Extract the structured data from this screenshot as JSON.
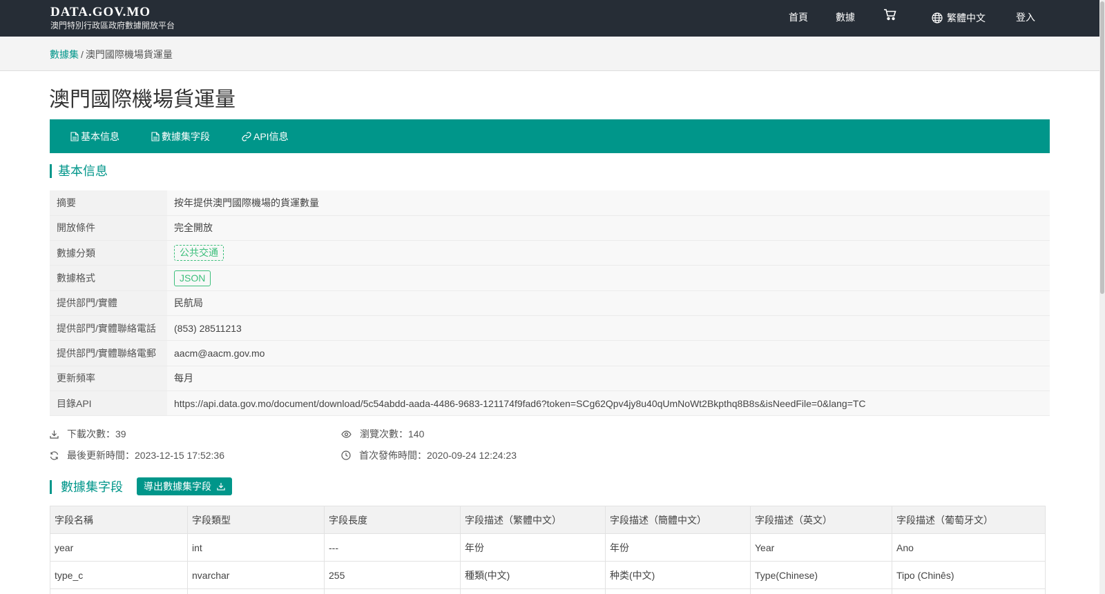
{
  "header": {
    "brand_title": "DATA.GOV.MO",
    "brand_subtitle": "澳門特別行政區政府數據開放平台",
    "nav": {
      "home": "首頁",
      "data": "數據",
      "language": "繁體中文",
      "login": "登入"
    }
  },
  "breadcrumb": {
    "root": "數據集",
    "separator": "/",
    "current": "澳門國際機場貨運量"
  },
  "page": {
    "title": "澳門國際機場貨運量"
  },
  "tabs": [
    {
      "label": "基本信息",
      "icon": "document-icon"
    },
    {
      "label": "數據集字段",
      "icon": "document-icon"
    },
    {
      "label": "API信息",
      "icon": "link-icon"
    }
  ],
  "basic_info": {
    "heading": "基本信息",
    "rows": [
      {
        "key": "摘要",
        "value": "按年提供澳門國際機場的貨運數量"
      },
      {
        "key": "開放條件",
        "value": "完全開放"
      },
      {
        "key": "數據分類",
        "value": "公共交通"
      },
      {
        "key": "數據格式",
        "value": "JSON"
      },
      {
        "key": "提供部門/實體",
        "value": "民航局"
      },
      {
        "key": "提供部門/實體聯絡電話",
        "value": "(853) 28511213"
      },
      {
        "key": "提供部門/實體聯絡電郵",
        "value": "aacm@aacm.gov.mo"
      },
      {
        "key": "更新頻率",
        "value": "每月"
      },
      {
        "key": "目錄API",
        "value": "https://api.data.gov.mo/document/download/5c54abdd-aada-4486-9683-121174f9fad6?token=SCg62Qpv4jy8u40qUmNoWt2Bkpthq8B8s&isNeedFile=0&lang=TC"
      }
    ]
  },
  "stats": {
    "downloads": "下載次數：39",
    "views": "瀏覽次數：140",
    "last_updated": "最後更新時間：2023-12-15 17:52:36",
    "first_published": "首次發佈時間：2020-09-24 12:24:23"
  },
  "fields_section": {
    "heading": "數據集字段",
    "export_label": "導出數據集字段",
    "columns": [
      "字段名稱",
      "字段類型",
      "字段長度",
      "字段描述（繁體中文）",
      "字段描述（簡體中文）",
      "字段描述（英文）",
      "字段描述（葡萄牙文）"
    ],
    "rows": [
      [
        "year",
        "int",
        "---",
        "年份",
        "年份",
        "Year",
        "Ano"
      ],
      [
        "type_c",
        "nvarchar",
        "255",
        "種類(中文)",
        "种类(中文)",
        "Type(Chinese)",
        "Tipo (Chinês)"
      ],
      [
        "",
        "",
        "",
        "",
        "",
        "",
        ""
      ]
    ]
  },
  "colors": {
    "accent": "#00968a",
    "header_bg": "#262d36",
    "tag_green": "#3cbf7b"
  }
}
